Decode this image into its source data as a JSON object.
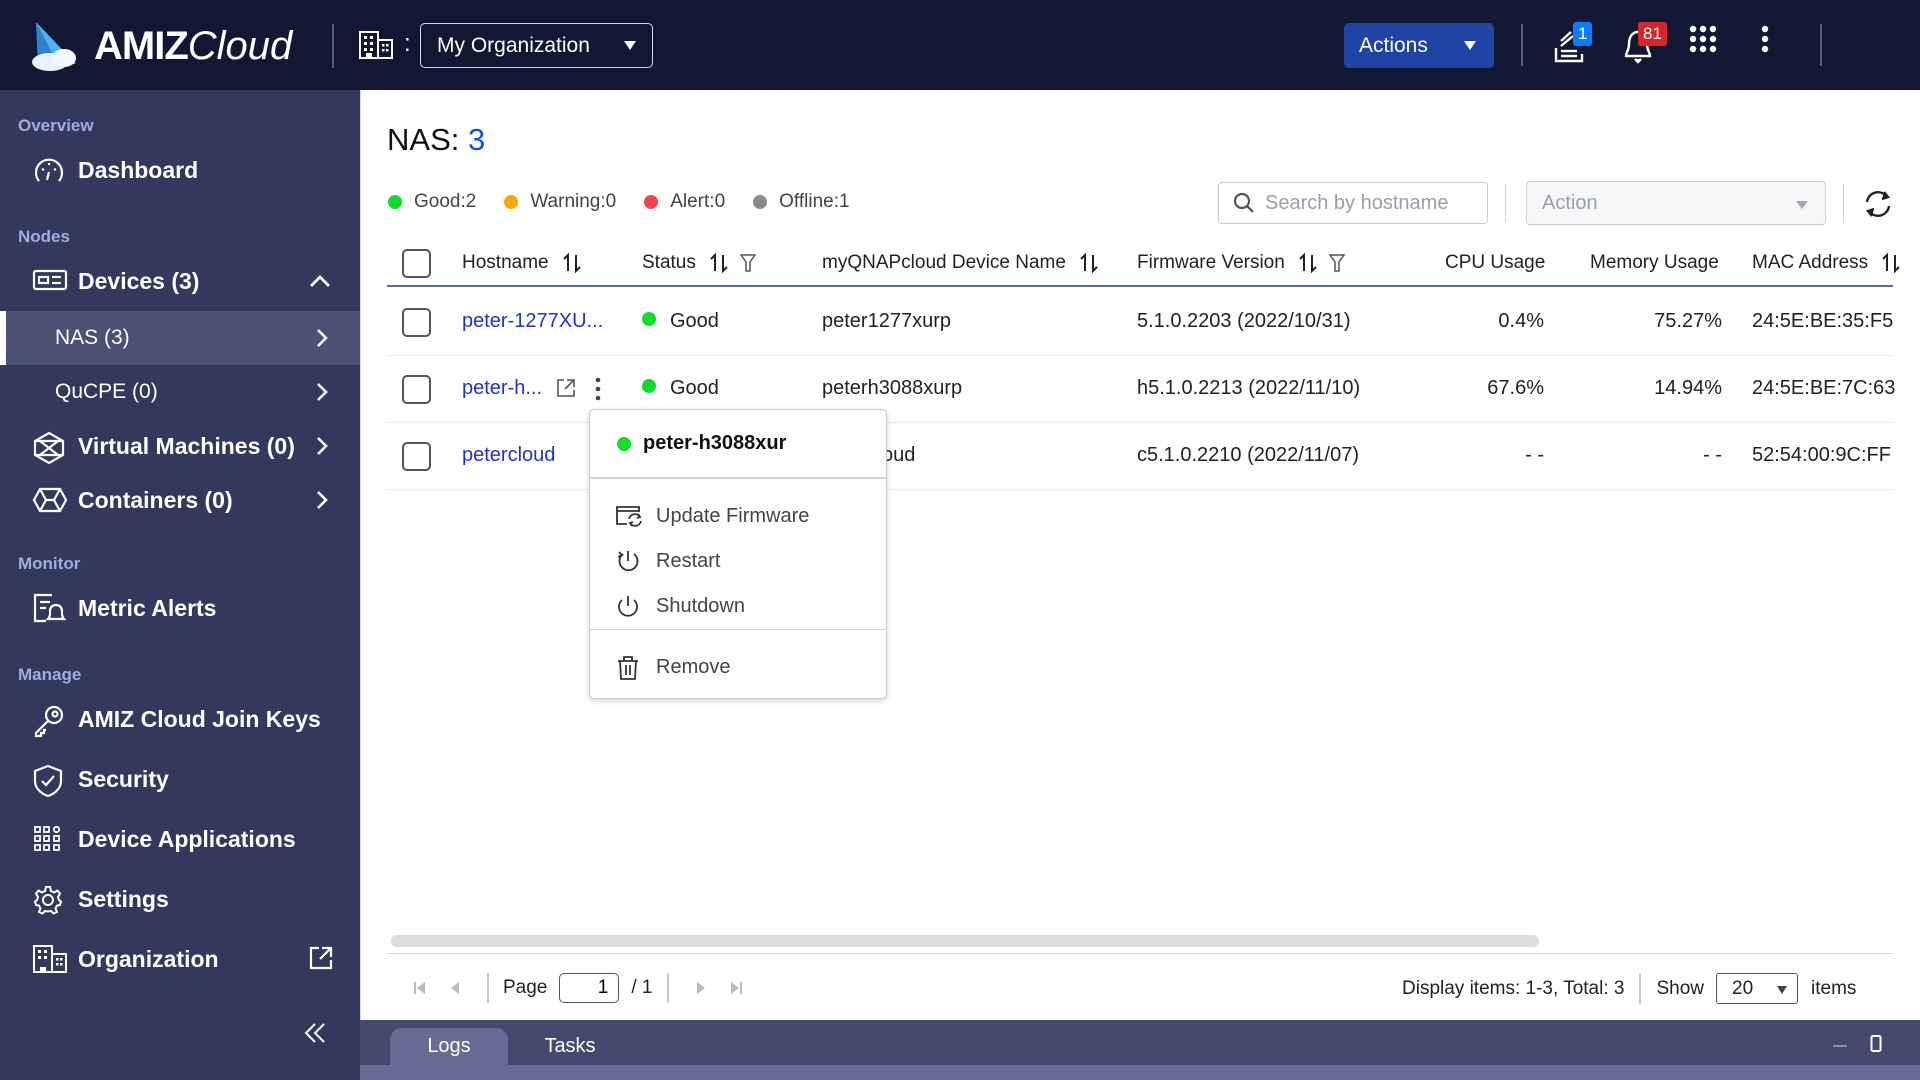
{
  "header": {
    "logo_primary": "AMIZ",
    "logo_secondary": "Cloud",
    "org_selected": "My Organization",
    "org_separator": ":",
    "actions_label": "Actions",
    "task_badge": "1",
    "notification_badge": "81"
  },
  "sidebar": {
    "sections": {
      "overview": "Overview",
      "nodes": "Nodes",
      "monitor": "Monitor",
      "manage": "Manage"
    },
    "items": {
      "dashboard": "Dashboard",
      "devices": "Devices (3)",
      "nas": "NAS (3)",
      "qucpe": "QuCPE (0)",
      "virtual_machines": "Virtual Machines (0)",
      "containers": "Containers (0)",
      "metric_alerts": "Metric Alerts",
      "join_keys": "AMIZ Cloud Join Keys",
      "security": "Security",
      "device_applications": "Device Applications",
      "settings": "Settings",
      "organization": "Organization"
    },
    "active_item": "NAS (3)"
  },
  "main": {
    "title_prefix": "NAS:",
    "title_count": "3",
    "legend": [
      {
        "label": "Good:2",
        "color": "#10dd2a"
      },
      {
        "label": "Warning:0",
        "color": "#f9a800"
      },
      {
        "label": "Alert:0",
        "color": "#f0454d"
      },
      {
        "label": "Offline:1",
        "color": "#8a8a8a"
      }
    ],
    "search_placeholder": "Search by hostname",
    "action_placeholder": "Action",
    "columns": [
      "Hostname",
      "Status",
      "myQNAPcloud Device Name",
      "Firmware Version",
      "CPU Usage",
      "Memory Usage",
      "MAC Address"
    ],
    "rows": [
      {
        "hostname": "peter-1277XU...",
        "status": "Good",
        "device_name": "peter1277xurp",
        "firmware": "5.1.0.2203 (2022/10/31)",
        "cpu": "0.4%",
        "memory": "75.27%",
        "mac": "24:5E:BE:35:F5"
      },
      {
        "hostname": "peter-h...",
        "status": "Good",
        "device_name": "peterh3088xurp",
        "firmware": "h5.1.0.2213 (2022/11/10)",
        "cpu": "67.6%",
        "memory": "14.94%",
        "mac": "24:5E:BE:7C:63"
      },
      {
        "hostname": "petercloud",
        "status": "",
        "device_name": "petercloud",
        "firmware": "c5.1.0.2210 (2022/11/07)",
        "cpu": "- -",
        "memory": "- -",
        "mac": "52:54:00:9C:FF"
      }
    ],
    "context_menu": {
      "device": "peter-h3088xur",
      "items": [
        "Update Firmware",
        "Restart",
        "Shutdown",
        "Remove"
      ]
    },
    "pagination": {
      "page_label": "Page",
      "current_page": "1",
      "total_pages": "/ 1",
      "display_info": "Display items: 1-3, Total: 3",
      "show_label": "Show",
      "page_size": "20",
      "items_label": "items"
    }
  },
  "bottom_panel": {
    "tabs": [
      "Logs",
      "Tasks"
    ],
    "active_tab": "Logs"
  }
}
